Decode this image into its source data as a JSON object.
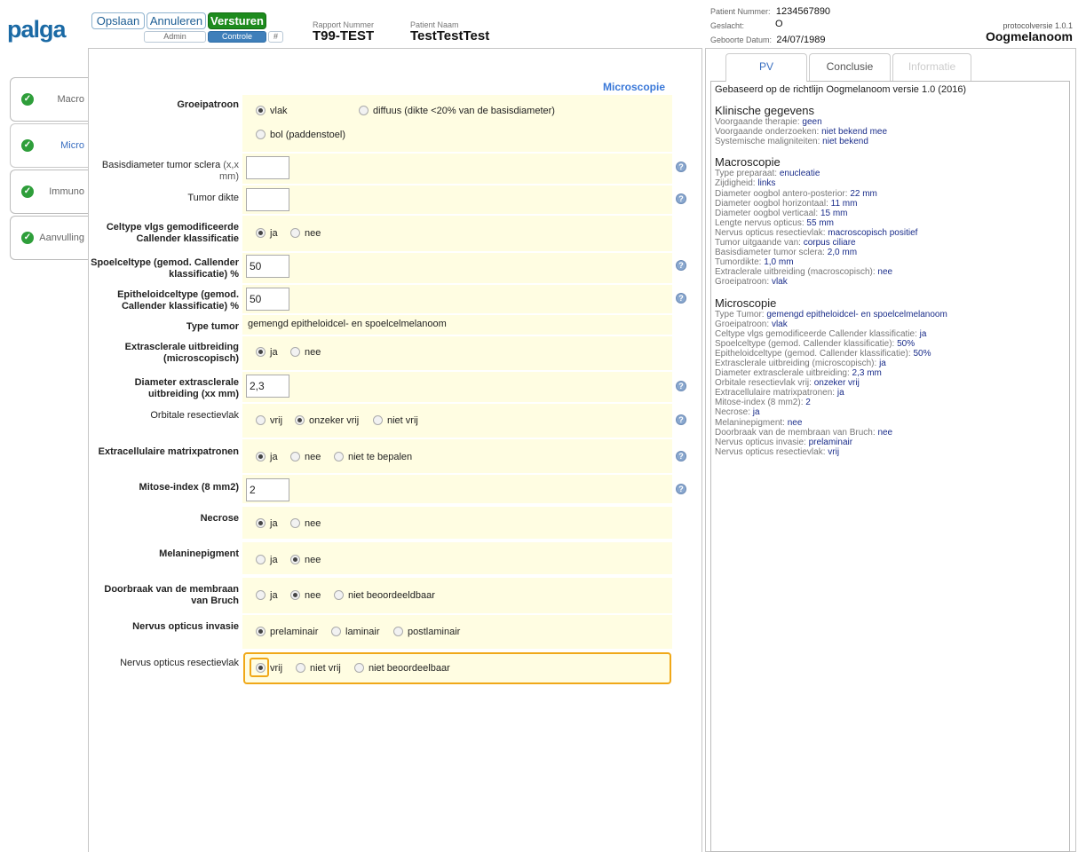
{
  "header": {
    "logo": "palga",
    "buttons": {
      "save": "Opslaan",
      "cancel": "Annuleren",
      "send": "Versturen"
    },
    "sub_buttons": {
      "admin": "Admin",
      "control": "Controle",
      "hash": "#"
    },
    "report_number_label": "Rapport Nummer",
    "report_number": "T99-TEST",
    "patient_name_label": "Patient Naam",
    "patient_name": "TestTestTest",
    "patient_number_label": "Patient Nummer:",
    "patient_number": "1234567890",
    "gender_label": "Geslacht:",
    "gender": "O",
    "birth_label": "Geboorte Datum:",
    "birth_date": "24/07/1989",
    "protocol_version": "protocolversie 1.0.1",
    "protocol_name": "Oogmelanoom"
  },
  "left_tabs": [
    {
      "label": "Macro"
    },
    {
      "label": "Micro"
    },
    {
      "label": "Immuno"
    },
    {
      "label": "Aanvulling"
    }
  ],
  "form": {
    "section_title": "Microscopie",
    "help_glyph": "?",
    "groeipatroon": {
      "label": "Groeipatroon",
      "opt1": "vlak",
      "opt2": "diffuus (dikte <20% van de basisdiameter)",
      "opt3": "bol (paddenstoel)"
    },
    "basisdiameter": {
      "label": "Basisdiameter tumor sclera",
      "label_sub": "(x,x mm)",
      "value": ""
    },
    "tumor_dikte": {
      "label": "Tumor dikte",
      "value": ""
    },
    "celtype": {
      "label": "Celtype vlgs gemodificeerde Callender klassificatie",
      "opt1": "ja",
      "opt2": "nee"
    },
    "spoelceltype": {
      "label": "Spoelceltype (gemod. Callender klassificatie) %",
      "value": "50"
    },
    "epitheloidceltype": {
      "label": "Epitheloidceltype (gemod. Callender klassificatie) %",
      "value": "50"
    },
    "type_tumor": {
      "label": "Type tumor",
      "value": "gemengd epitheloidcel- en spoelcelmelanoom"
    },
    "extrasclerale": {
      "label": "Extrasclerale uitbreiding (microscopisch)",
      "opt1": "ja",
      "opt2": "nee"
    },
    "diameter_extra": {
      "label": "Diameter extrasclerale uitbreiding (xx mm)",
      "value": "2,3"
    },
    "orbitale": {
      "label": "Orbitale resectievlak",
      "opt1": "vrij",
      "opt2": "onzeker vrij",
      "opt3": "niet vrij"
    },
    "matrix": {
      "label": "Extracellulaire matrixpatronen",
      "opt1": "ja",
      "opt2": "nee",
      "opt3": "niet te bepalen"
    },
    "mitose": {
      "label": "Mitose-index (8 mm2)",
      "value": "2"
    },
    "necrose": {
      "label": "Necrose",
      "opt1": "ja",
      "opt2": "nee"
    },
    "melanine": {
      "label": "Melaninepigment",
      "opt1": "ja",
      "opt2": "nee"
    },
    "doorbraak": {
      "label": "Doorbraak van de membraan van Bruch",
      "opt1": "ja",
      "opt2": "nee",
      "opt3": "niet beoordeeldbaar"
    },
    "invasie": {
      "label": "Nervus opticus invasie",
      "opt1": "prelaminair",
      "opt2": "laminair",
      "opt3": "postlaminair"
    },
    "resectievlak": {
      "label": "Nervus opticus resectievlak",
      "opt1": "vrij",
      "opt2": "niet vrij",
      "opt3": "niet beoordeelbaar"
    }
  },
  "right_panel": {
    "tabs": [
      "PV",
      "Conclusie",
      "Informatie"
    ],
    "intro": "Gebaseerd op de richtlijn Oogmelanoom versie 1.0 (2016)",
    "sections": [
      {
        "heading": "Klinische gegevens",
        "items": [
          {
            "k": "Voorgaande therapie:",
            "v": "geen"
          },
          {
            "k": "Voorgaande onderzoeken:",
            "v": "niet bekend mee"
          },
          {
            "k": "Systemische maligniteiten:",
            "v": "niet bekend"
          }
        ]
      },
      {
        "heading": "Macroscopie",
        "items": [
          {
            "k": "Type preparaat:",
            "v": "enucleatie"
          },
          {
            "k": "Zijdigheid:",
            "v": "links"
          },
          {
            "k": "Diameter oogbol antero-posterior:",
            "v": "22 mm"
          },
          {
            "k": "Diameter oogbol horizontaal:",
            "v": "11 mm"
          },
          {
            "k": "Diameter oogbol verticaal:",
            "v": "15 mm"
          },
          {
            "k": "Lengte nervus opticus:",
            "v": "55 mm"
          },
          {
            "k": "Nervus opticus resectievlak:",
            "v": "macroscopisch positief"
          },
          {
            "k": "Tumor uitgaande van:",
            "v": "corpus ciliare"
          },
          {
            "k": "Basisdiameter tumor sclera:",
            "v": "2,0 mm"
          },
          {
            "k": "Tumordikte:",
            "v": "1,0 mm"
          },
          {
            "k": "Extraclerale uitbreiding (macroscopisch):",
            "v": "nee"
          },
          {
            "k": "Groeipatroon:",
            "v": "vlak"
          }
        ]
      },
      {
        "heading": "Microscopie",
        "items": [
          {
            "k": "Type Tumor:",
            "v": "gemengd epitheloidcel- en spoelcelmelanoom"
          },
          {
            "k": "Groeipatroon:",
            "v": "vlak"
          },
          {
            "k": "Celtype vlgs gemodificeerde Callender klassificatie:",
            "v": "ja"
          },
          {
            "k": "Spoelceltype (gemod. Callender klassificatie):",
            "v": "50%"
          },
          {
            "k": "Epitheloidceltype (gemod. Callender klassificatie):",
            "v": "50%"
          },
          {
            "k": "Extrasclerale uitbreiding (microscopisch):",
            "v": "ja"
          },
          {
            "k": "Diameter extrasclerale uitbreiding:",
            "v": "2,3 mm"
          },
          {
            "k": "Orbitale resectievlak vrij:",
            "v": "onzeker vrij"
          },
          {
            "k": "Extracellulaire matrixpatronen:",
            "v": "ja"
          },
          {
            "k": "Mitose-index (8 mm2):",
            "v": "2"
          },
          {
            "k": "Necrose:",
            "v": "ja"
          },
          {
            "k": "Melaninepigment:",
            "v": "nee"
          },
          {
            "k": "Doorbraak van de membraan van Bruch:",
            "v": "nee"
          },
          {
            "k": "Nervus opticus invasie:",
            "v": "prelaminair"
          },
          {
            "k": "Nervus opticus resectievlak:",
            "v": "vrij"
          }
        ]
      }
    ]
  }
}
